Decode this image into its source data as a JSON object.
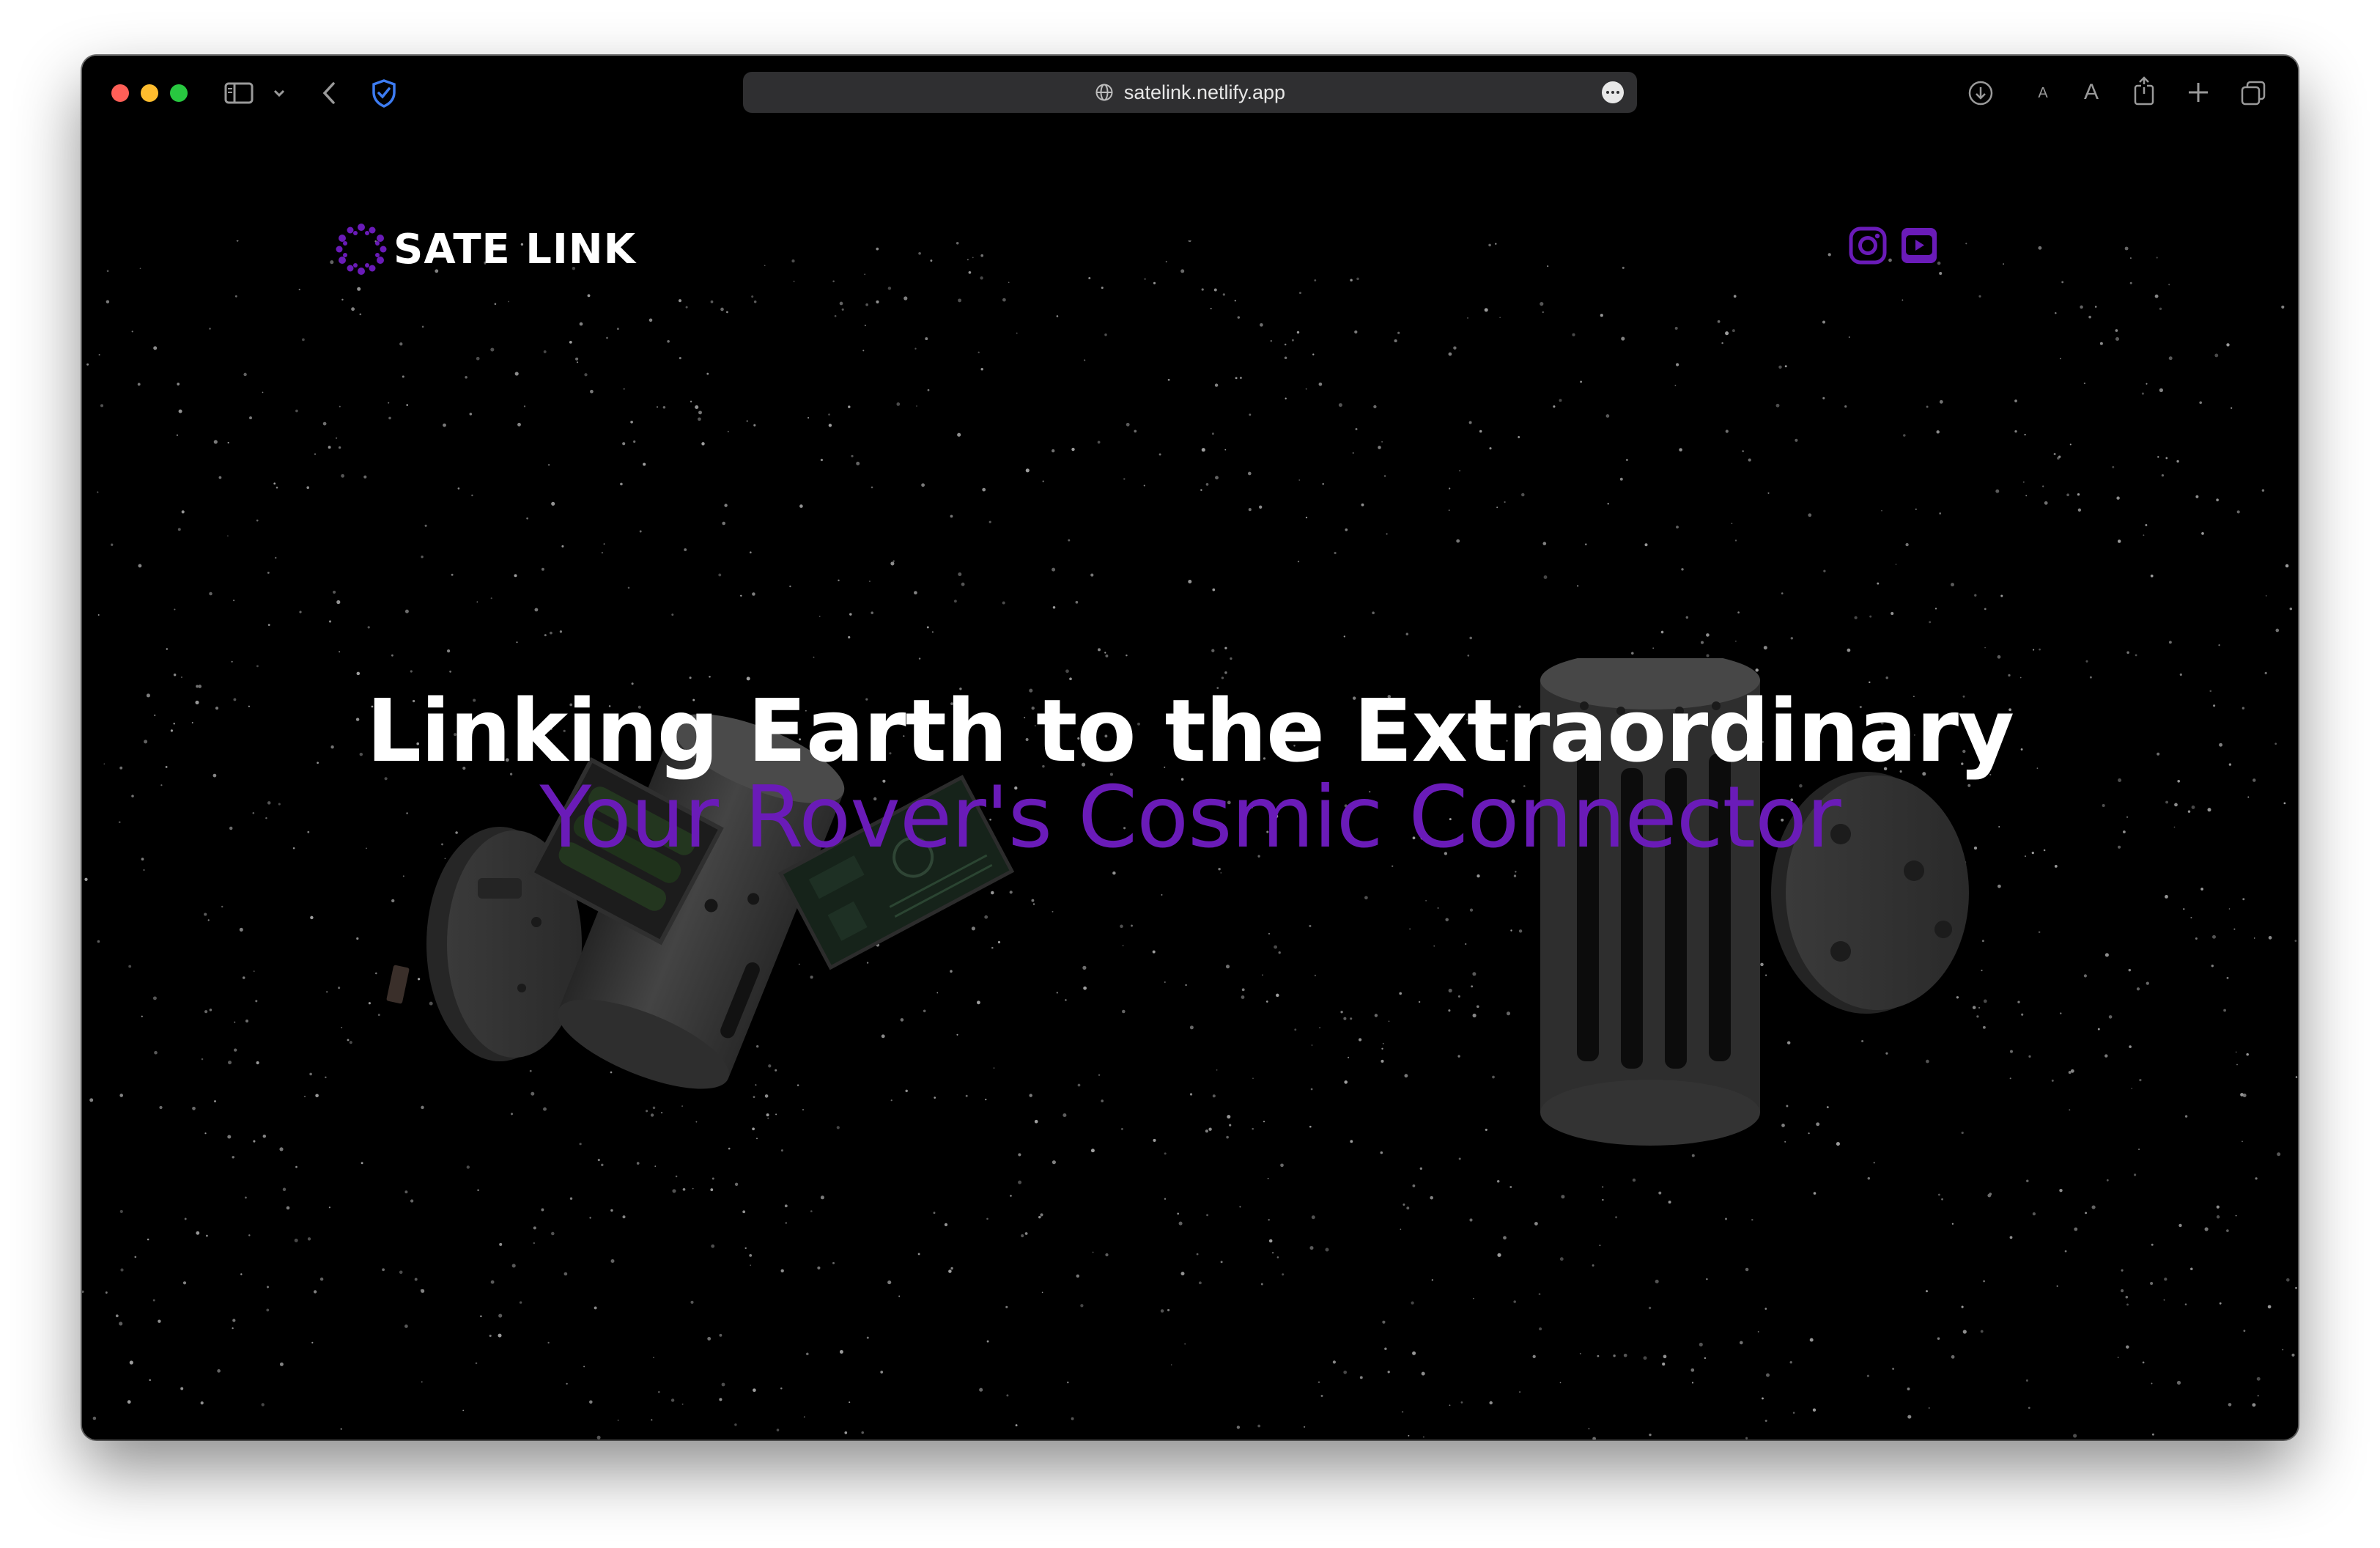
{
  "browser": {
    "url": "satelink.netlify.app",
    "font_small_label": "A",
    "font_large_label": "A"
  },
  "site": {
    "logo_text": "SATE LINK",
    "hero_title": "Linking Earth to the Extraordinary",
    "hero_subtitle": "Your Rover's Cosmic Connector",
    "social_icons": [
      "instagram-icon",
      "youtube-icon"
    ],
    "colors": {
      "accent": "#6a1bb8",
      "background": "#000000",
      "text": "#ffffff"
    }
  }
}
